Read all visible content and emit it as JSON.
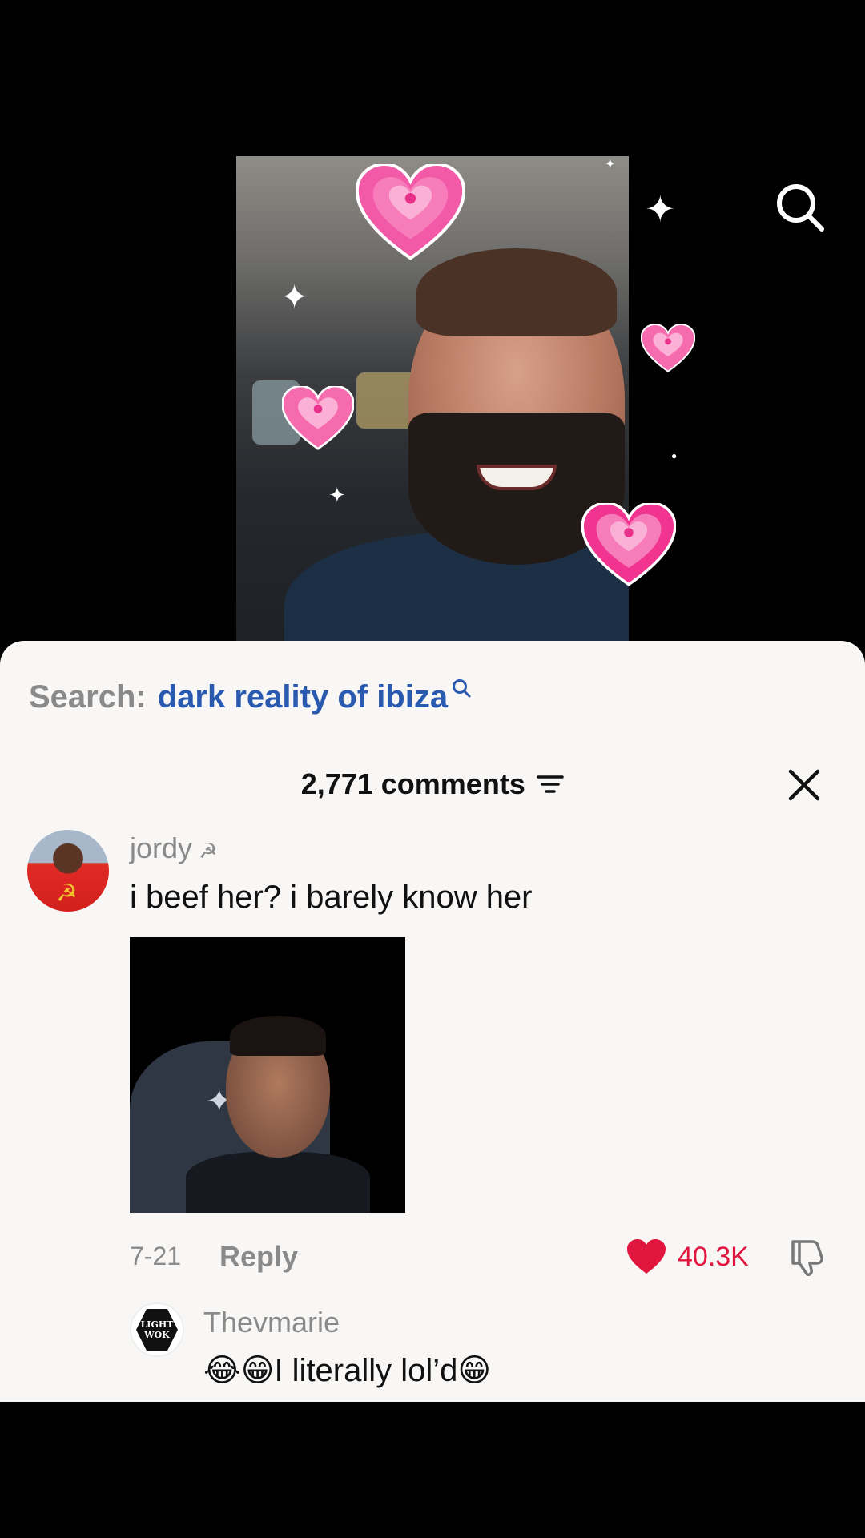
{
  "top": {
    "search_icon": "search-icon"
  },
  "video": {
    "stickers": [
      "heart-sticker",
      "sparkle-sticker"
    ],
    "accent_pink": "#f25aa8"
  },
  "sheet": {
    "search_prefix": "Search:",
    "search_term": "dark reality of ibiza",
    "comments_count": "2,771 comments",
    "filter_icon": "filter-icon",
    "close_icon": "close-icon"
  },
  "comments": [
    {
      "username": "jordy",
      "flag": "☭",
      "text": "i beef her? i barely know her",
      "avatar_mark": "☭",
      "date": "7-21",
      "reply_label": "Reply",
      "likes": "40.3K",
      "liked": true
    },
    {
      "username": "Thevmarie",
      "avatar_text": "LIGHT WOK",
      "text": "😂😁I literally lol’d😁"
    }
  ],
  "colors": {
    "like_red": "#e0163f",
    "link_blue": "#2a59b0",
    "muted_gray": "#8a8a8a",
    "sheet_bg": "#f8f7f5"
  }
}
